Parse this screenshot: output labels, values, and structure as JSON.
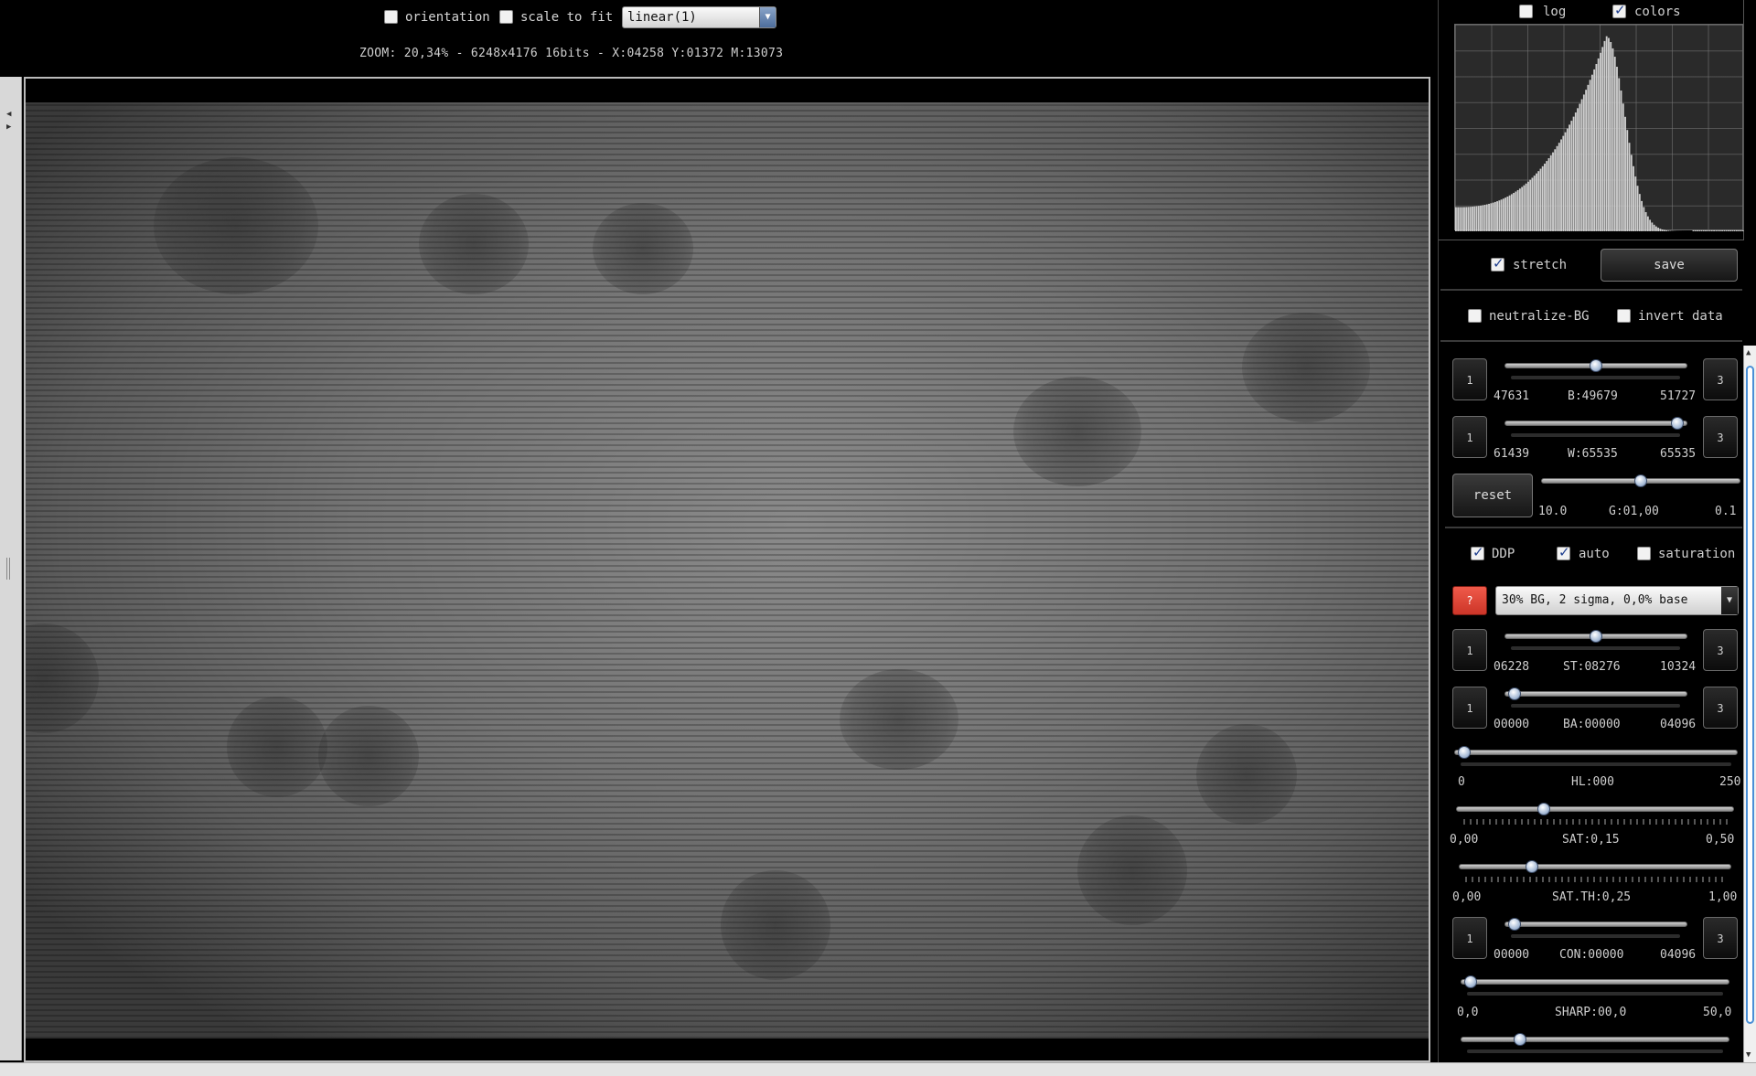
{
  "toolbar": {
    "orientation_label": "orientation",
    "orientation_checked": false,
    "scale_label": "scale to fit",
    "scale_checked": false,
    "stretch_mode": "linear(1)",
    "zoom_info": "ZOOM: 20,34% - 6248x4176 16bits - X:04258 Y:01372 M:13073"
  },
  "histogram": {
    "log_label": "log",
    "log_checked": false,
    "colors_label": "colors",
    "colors_checked": true
  },
  "panel": {
    "stretch_label": "stretch",
    "stretch_checked": true,
    "save_label": "save",
    "neutralize_label": "neutralize-BG",
    "neutralize_checked": false,
    "invert_label": "invert data",
    "invert_checked": false,
    "step_down_label": "1",
    "step_up_label": "3",
    "black": {
      "min": "47631",
      "label": "B:49679",
      "max": "51727",
      "position": 0.5
    },
    "white": {
      "min": "61439",
      "label": "W:65535",
      "max": "65535",
      "position": 1.0
    },
    "reset_label": "reset",
    "gamma": {
      "min": "10.0",
      "label": "G:01,00",
      "max": "0.1",
      "position": 0.5
    },
    "ddp_label": "DDP",
    "ddp_checked": true,
    "auto_label": "auto",
    "auto_checked": true,
    "saturation_label": "saturation",
    "saturation_checked": false,
    "help_label": "?",
    "preset": "30% BG, 2 sigma, 0,0% base",
    "st": {
      "min": "06228",
      "label": "ST:08276",
      "max": "10324",
      "position": 0.5
    },
    "ba": {
      "min": "00000",
      "label": "BA:00000",
      "max": "04096",
      "position": 0.0
    },
    "hl": {
      "min": "0",
      "label": "HL:000",
      "max": "250",
      "position": 0.0
    },
    "sat": {
      "min": "0,00",
      "label": "SAT:0,15",
      "max": "0,50",
      "position": 0.3
    },
    "sat_th": {
      "min": "0,00",
      "label": "SAT.TH:0,25",
      "max": "1,00",
      "position": 0.25
    },
    "con": {
      "min": "00000",
      "label": "CON:00000",
      "max": "04096",
      "position": 0.0
    },
    "sharp": {
      "min": "0,0",
      "label": "SHARP:00,0",
      "max": "50,0",
      "position": 0.0
    },
    "extra_slider_position": 0.2
  },
  "colors": {
    "background": "#000000",
    "histogram_bars": "#cfcfcf",
    "help_button": "#e0453a",
    "slider_knob": "#a9bdd8",
    "scroll_thumb": "#4a8fd6"
  }
}
